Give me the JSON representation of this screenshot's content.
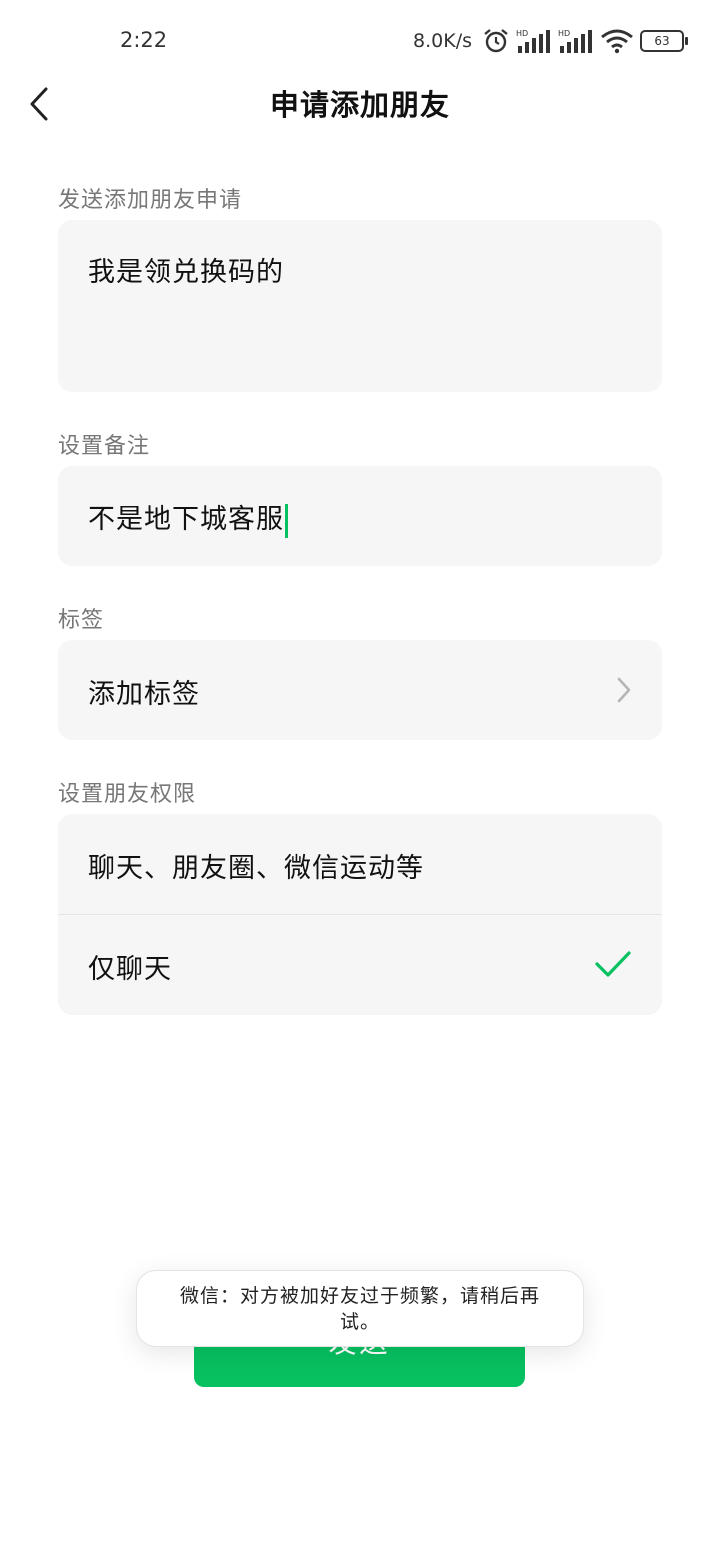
{
  "status_bar": {
    "time": "2:22",
    "net_speed": "8.0K/s",
    "battery": "63",
    "icons": [
      "alarm-icon",
      "hd-signal-icon",
      "hd-signal-icon",
      "wifi-icon",
      "battery-icon"
    ]
  },
  "nav": {
    "title": "申请添加朋友",
    "back_icon": "chevron-left-icon"
  },
  "request": {
    "label": "发送添加朋友申请",
    "value": "我是领兑换码的"
  },
  "remark": {
    "label": "设置备注",
    "value": "不是地下城客服"
  },
  "tags": {
    "label": "标签",
    "add_label": "添加标签",
    "chevron_icon": "chevron-right-icon"
  },
  "permissions": {
    "label": "设置朋友权限",
    "options": [
      {
        "label": "聊天、朋友圈、微信运动等",
        "selected": false
      },
      {
        "label": "仅聊天",
        "selected": true
      }
    ],
    "check_icon": "checkmark-icon"
  },
  "send_button": {
    "label": "发送"
  },
  "toast": {
    "text": "微信：对方被加好友过于频繁，请稍后再试。"
  },
  "colors": {
    "accent": "#07c160",
    "field_bg": "#f6f6f6",
    "label": "#777777"
  }
}
